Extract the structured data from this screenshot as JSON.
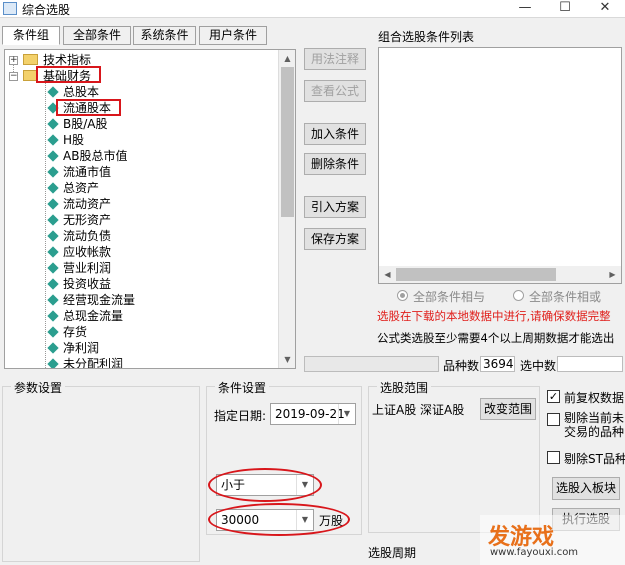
{
  "window": {
    "title": "综合选股",
    "minimize": "—",
    "maximize": "☐",
    "close": "✕"
  },
  "tabs": [
    "条件组",
    "全部条件",
    "系统条件",
    "用户条件"
  ],
  "tree": {
    "folder_tech": "技术指标",
    "folder_fin": "基础财务",
    "items": [
      "总股本",
      "流通股本",
      "B股/A股",
      "H股",
      "AB股总市值",
      "流通市值",
      "总资产",
      "流动资产",
      "无形资产",
      "流动负债",
      "应收帐款",
      "营业利润",
      "投资收益",
      "经营现金流量",
      "总现金流量",
      "存货",
      "净利润",
      "未分配利润"
    ]
  },
  "buttons": {
    "usage_note": "用法注释",
    "view_formula": "查看公式",
    "add_condition": "加入条件",
    "delete_condition": "删除条件",
    "import_plan": "引入方案",
    "save_plan": "保存方案",
    "change_range": "改变范围",
    "select_to_block": "选股入板块",
    "execute_select": "执行选股"
  },
  "condition_list": {
    "title": "组合选股条件列表"
  },
  "logic": {
    "and_label": "全部条件相与",
    "or_label": "全部条件相或"
  },
  "notes": {
    "red_note": "选股在下载的本地数据中进行,请确保数据完整",
    "formula_note": "公式类选股至少需要4个以上周期数据才能选出"
  },
  "stats": {
    "count_label": "品种数",
    "count_value": "3694",
    "selected_label": "选中数"
  },
  "param_settings": {
    "title": "参数设置"
  },
  "condition_settings": {
    "title": "条件设置",
    "date_label": "指定日期:",
    "date_value": "2019-09-21",
    "operator_value": "小于",
    "amount_value": "30000",
    "unit": "万股"
  },
  "range": {
    "title": "选股范围",
    "value": "上证A股 深证A股",
    "period_label": "选股周期"
  },
  "options": {
    "prev_adjust": "前复权数据",
    "exclude_suspended": "剔除当前未交易的品种",
    "exclude_st": "剔除ST品种"
  },
  "watermark": {
    "brand": "发游戏",
    "url": "www.fayouxi.com"
  },
  "colors": {
    "highlight_red": "#d8161b",
    "warning_red": "#e0201c"
  }
}
